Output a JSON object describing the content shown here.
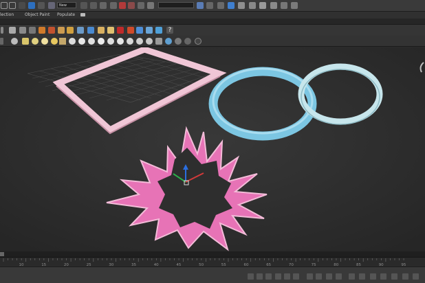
{
  "main_toolbar": {
    "selection_filter_value": "",
    "named_set_value": "New"
  },
  "ribbon": {
    "tabs": [
      "lection",
      "Object Paint",
      "Populate"
    ]
  },
  "timeline": {
    "tick_labels": [
      "10",
      "15",
      "20",
      "25",
      "30",
      "35",
      "40",
      "45",
      "50",
      "55",
      "60",
      "65",
      "70",
      "75",
      "80",
      "85",
      "90",
      "95"
    ]
  },
  "colors": {
    "viewport_bg": "#2e2e2e",
    "pink_object": "#e774b6",
    "light_pink_frame": "#f3c8d8",
    "blue_ring": "#7fc8e4",
    "light_ring": "#cfeaf0"
  }
}
